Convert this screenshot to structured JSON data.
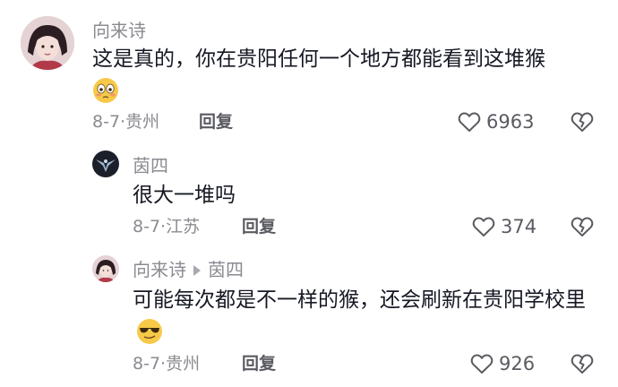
{
  "comments": [
    {
      "username": "向来诗",
      "text": "这是真的，你在贵阳任何一个地方都能看到这堆猴",
      "emoji": "flushed-face-emoji",
      "date": "8-7",
      "location": "贵州",
      "reply_label": "回复",
      "likes": "6963"
    },
    {
      "username": "茵四",
      "text": "很大一堆吗",
      "date": "8-7",
      "location": "江苏",
      "reply_label": "回复",
      "likes": "374"
    },
    {
      "username": "向来诗",
      "reply_to": "茵四",
      "text": "可能每次都是不一样的猴，还会刷新在贵阳学校里",
      "emoji": "sunglasses-smirk-emoji",
      "date": "8-7",
      "location": "贵州",
      "reply_label": "回复",
      "likes": "926"
    }
  ],
  "meta_separator": "·",
  "colors": {
    "text": "#161823",
    "secondary": "#8a8b91",
    "icon": "#5a5b61"
  }
}
